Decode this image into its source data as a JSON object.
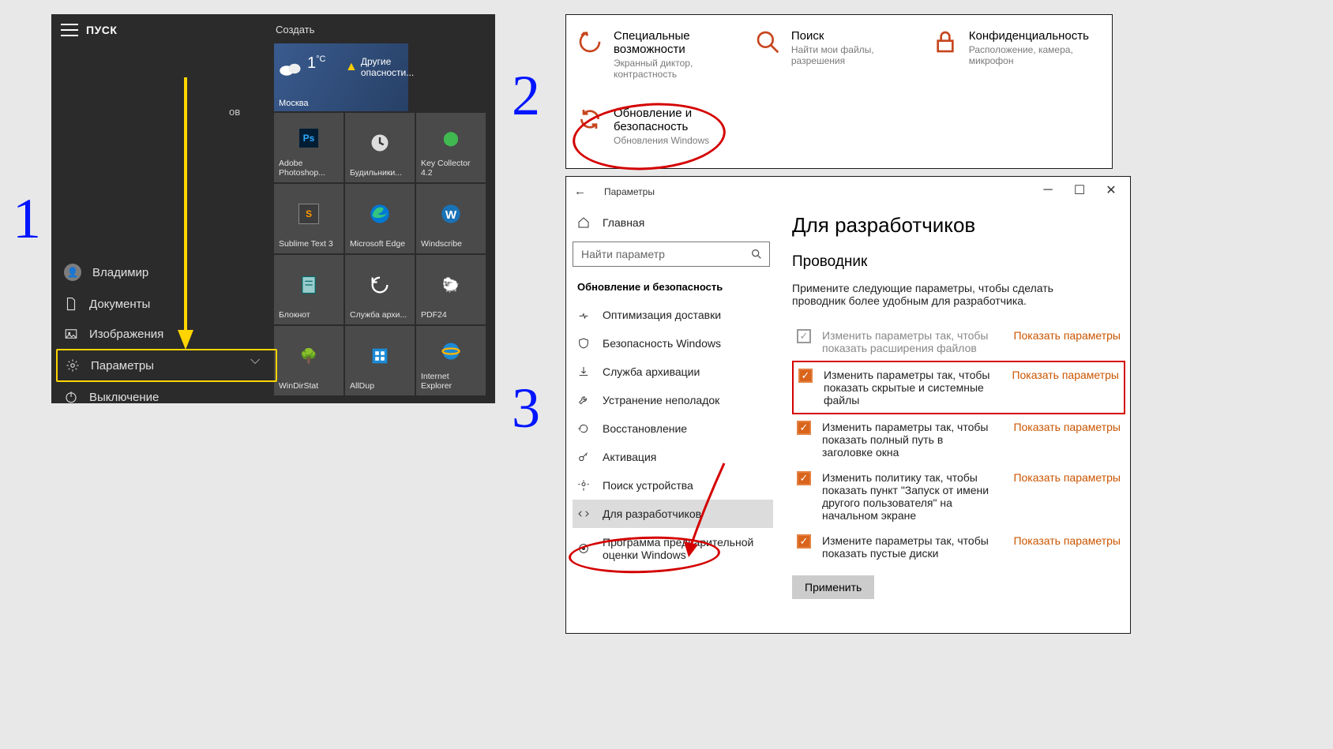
{
  "steps": {
    "s1": "1",
    "s2": "2",
    "s3": "3"
  },
  "start": {
    "title": "ПУСК",
    "create": "Создать",
    "weather": {
      "city": "Москва",
      "temp": "1",
      "unit": "°C",
      "alert_line1": "Другие",
      "alert_line2": "опасности..."
    },
    "tiles": [
      {
        "label": "Adobe Photoshop..."
      },
      {
        "label": "Будильники..."
      },
      {
        "label": "Key Collector 4.2"
      },
      {
        "label": "Sublime Text 3"
      },
      {
        "label": "Microsoft Edge"
      },
      {
        "label": "Windscribe"
      },
      {
        "label": "Блокнот"
      },
      {
        "label": "Служба архи..."
      },
      {
        "label": "PDF24"
      },
      {
        "label": "WinDirStat"
      },
      {
        "label": "AllDup"
      },
      {
        "label": "Internet Explorer"
      }
    ],
    "ov_suffix": "ов",
    "user": "Владимир",
    "left_items": {
      "documents": "Документы",
      "pictures": "Изображения",
      "settings": "Параметры",
      "power": "Выключение"
    }
  },
  "settings_cats": {
    "access": {
      "title": "Специальные возможности",
      "desc": "Экранный диктор, контрастность"
    },
    "search": {
      "title": "Поиск",
      "desc": "Найти мои файлы, разрешения"
    },
    "privacy": {
      "title": "Конфиденциальность",
      "desc": "Расположение, камера, микрофон"
    },
    "update": {
      "title": "Обновление и безопасность",
      "desc": "Обновления Windows"
    }
  },
  "settings_win": {
    "title": "Параметры",
    "home": "Главная",
    "search_placeholder": "Найти параметр",
    "section": "Обновление и безопасность",
    "nav": [
      "Оптимизация доставки",
      "Безопасность Windows",
      "Служба архивации",
      "Устранение неполадок",
      "Восстановление",
      "Активация",
      "Поиск устройства",
      "Для разработчиков",
      "Программа предварительной оценки Windows"
    ],
    "main": {
      "h1": "Для разработчиков",
      "h2": "Проводник",
      "desc": "Примените следующие параметры, чтобы сделать проводник более удобным для разработчика.",
      "show": "Показать параметры",
      "opts": [
        "Изменить параметры так, чтобы показать расширения файлов",
        "Изменить параметры так, чтобы показать скрытые и системные файлы",
        "Изменить параметры так, чтобы показать полный путь в заголовке окна",
        "Изменить политику так, чтобы показать пункт \"Запуск от имени другого пользователя\" на начальном экране",
        "Измените параметры так, чтобы показать пустые диски"
      ],
      "apply": "Применить"
    }
  }
}
